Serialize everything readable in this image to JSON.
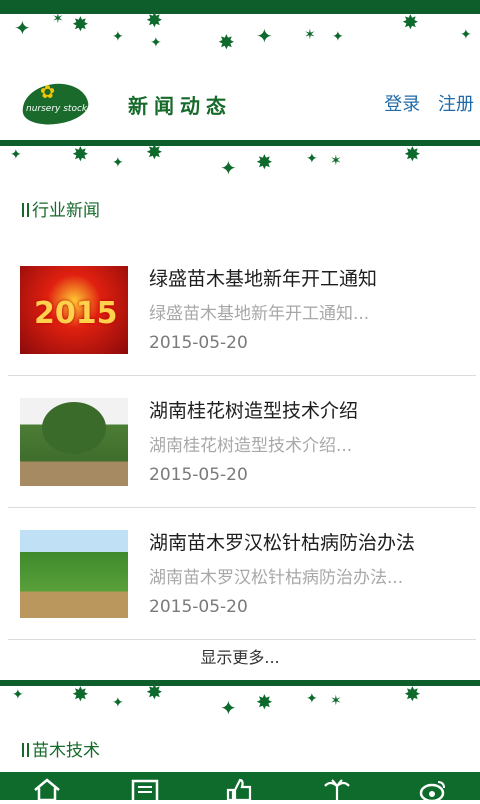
{
  "header": {
    "title": "新闻动态",
    "login_label": "登录",
    "register_label": "注册",
    "logo_text": "nursery stock"
  },
  "sections": [
    {
      "title": "行业新闻"
    },
    {
      "title": "苗木技术"
    }
  ],
  "news": [
    {
      "title": "绿盛苗木基地新年开工通知",
      "summary": "绿盛苗木基地新年开工通知...",
      "date": "2015-05-20",
      "thumb_text": "2015"
    },
    {
      "title": "湖南桂花树造型技术介绍",
      "summary": "湖南桂花树造型技术介绍...",
      "date": "2015-05-20"
    },
    {
      "title": "湖南苗木罗汉松针枯病防治办法",
      "summary": "湖南苗木罗汉松针枯病防治办法...",
      "date": "2015-05-20"
    }
  ],
  "more_label": "显示更多...",
  "bottom_nav": [
    "home-icon",
    "news-icon",
    "thumbs-up-icon",
    "palm-tree-icon",
    "weibo-icon"
  ],
  "colors": {
    "brand_green": "#0d5e2a",
    "link_blue": "#1f6aa8"
  }
}
